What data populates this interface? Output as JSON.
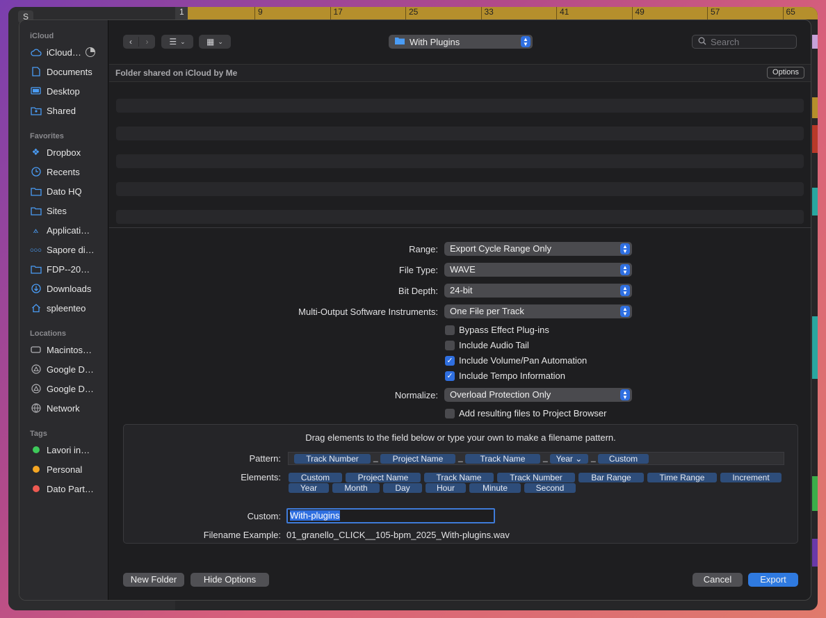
{
  "background": {
    "track_button": "S",
    "ruler_numbers": [
      "1",
      "9",
      "17",
      "25",
      "33",
      "41",
      "49",
      "57",
      "65"
    ]
  },
  "sidebar": {
    "sections": [
      {
        "title": "iCloud",
        "items": [
          {
            "label": "iCloud…",
            "icon": "cloud-icon"
          },
          {
            "label": "Documents",
            "icon": "document-icon"
          },
          {
            "label": "Desktop",
            "icon": "desktop-icon"
          },
          {
            "label": "Shared",
            "icon": "shared-folder-icon"
          }
        ]
      },
      {
        "title": "Favorites",
        "items": [
          {
            "label": "Dropbox",
            "icon": "dropbox-icon"
          },
          {
            "label": "Recents",
            "icon": "clock-icon"
          },
          {
            "label": "Dato HQ",
            "icon": "folder-icon"
          },
          {
            "label": "Sites",
            "icon": "folder-icon"
          },
          {
            "label": "Applicati…",
            "icon": "applications-icon"
          },
          {
            "label": "Sapore di…",
            "icon": "group-icon"
          },
          {
            "label": "FDP--20…",
            "icon": "folder-icon"
          },
          {
            "label": "Downloads",
            "icon": "download-icon"
          },
          {
            "label": "spleenteo",
            "icon": "home-icon"
          }
        ]
      },
      {
        "title": "Locations",
        "items": [
          {
            "label": "Macintos…",
            "icon": "disk-icon"
          },
          {
            "label": "Google D…",
            "icon": "drive-icon"
          },
          {
            "label": "Google D…",
            "icon": "drive-icon"
          },
          {
            "label": "Network",
            "icon": "network-icon"
          }
        ]
      },
      {
        "title": "Tags",
        "items": [
          {
            "label": "Lavori in…",
            "color": "#3ec95a"
          },
          {
            "label": "Personal",
            "color": "#f5a623"
          },
          {
            "label": "Dato Part…",
            "color": "#ee5a52"
          }
        ]
      }
    ]
  },
  "toolbar": {
    "folder": "With Plugins",
    "search_placeholder": "Search"
  },
  "location_info": "Folder shared on iCloud by Me",
  "options_label": "Options",
  "form": {
    "range_label": "Range:",
    "range_value": "Export Cycle Range Only",
    "filetype_label": "File Type:",
    "filetype_value": "WAVE",
    "bitdepth_label": "Bit Depth:",
    "bitdepth_value": "24-bit",
    "multi_label": "Multi-Output Software Instruments:",
    "multi_value": "One File per Track",
    "checks": [
      {
        "label": "Bypass Effect Plug-ins",
        "checked": false
      },
      {
        "label": "Include Audio Tail",
        "checked": false
      },
      {
        "label": "Include Volume/Pan Automation",
        "checked": true
      },
      {
        "label": "Include Tempo Information",
        "checked": true
      }
    ],
    "normalize_label": "Normalize:",
    "normalize_value": "Overload Protection Only",
    "add_files_label": "Add resulting files to Project Browser",
    "add_files_checked": false
  },
  "pattern": {
    "instructions": "Drag elements to the field below or type your own to make a filename pattern.",
    "pattern_label": "Pattern:",
    "tokens": [
      "Track Number",
      "Project Name",
      "Track Name",
      "Year ⌄",
      "Custom"
    ],
    "separator": "_",
    "elements_label": "Elements:",
    "elements": [
      "Custom",
      "Project Name",
      "Track Name",
      "Track Number",
      "Bar Range",
      "Time Range",
      "Increment",
      "Year",
      "Month",
      "Day",
      "Hour",
      "Minute",
      "Second"
    ],
    "custom_label": "Custom:",
    "custom_value": "With-plugins",
    "example_label": "Filename Example:",
    "example_value": "01_granello_CLICK__105-bpm_2025_With-plugins.wav"
  },
  "buttons": {
    "new_folder": "New Folder",
    "hide_options": "Hide Options",
    "cancel": "Cancel",
    "export": "Export"
  },
  "colors": {
    "accent": "#2f7ae0",
    "token": "#2e4d7a"
  }
}
